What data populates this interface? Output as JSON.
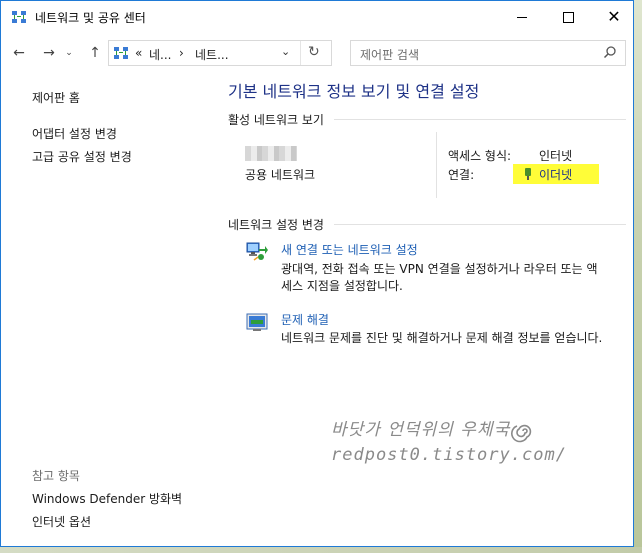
{
  "window": {
    "title": "네트워크 및 공유 센터",
    "controls": {
      "minimize": "minimize",
      "maximize": "maximize",
      "close": "✕"
    }
  },
  "nav": {
    "back": "←",
    "forward": "→",
    "history": "⌄",
    "up": "↑",
    "address": {
      "overflow": "«",
      "seg1": "네...",
      "sep": "›",
      "seg2": "네트..."
    },
    "dropdown": "⌄",
    "refresh": "↻",
    "search_placeholder": "제어판 검색"
  },
  "left_pane": {
    "home": "제어판 홈",
    "adapter_settings": "어댑터 설정 변경",
    "advanced_sharing": "고급 공유 설정 변경",
    "see_also": "참고 항목",
    "defender": "Windows Defender 방화벽",
    "internet_options": "인터넷 옵션"
  },
  "main": {
    "title": "기본 네트워크 정보 보기 및 연결 설정",
    "active_networks": {
      "heading": "활성 네트워크 보기",
      "network_type": "공용 네트워크",
      "access_type_label": "액세스 형식:",
      "access_type_value": "인터넷",
      "connections_label": "연결:",
      "connections_value": "이더넷"
    },
    "change_settings": {
      "heading": "네트워크 설정 변경",
      "tasks": [
        {
          "link": "새 연결 또는 네트워크 설정",
          "desc1": "광대역, 전화 접속 또는 VPN 연결을 설정하거나 라우터 또는 액",
          "desc2": "세스 지점을 설정합니다."
        },
        {
          "link": "문제 해결",
          "desc1": "네트워크 문제를 진단 및 해결하거나 문제 해결 정보를 얻습니다."
        }
      ]
    }
  },
  "watermark": {
    "line1": "바닷가 언덕위의 우체국",
    "line2": "redpost0.tistory.com/"
  },
  "colors": {
    "title_blue": "#1e3287",
    "link_blue": "#1e5fb4",
    "highlight_yellow": "#fffd38",
    "window_border": "#1f7ad6"
  }
}
